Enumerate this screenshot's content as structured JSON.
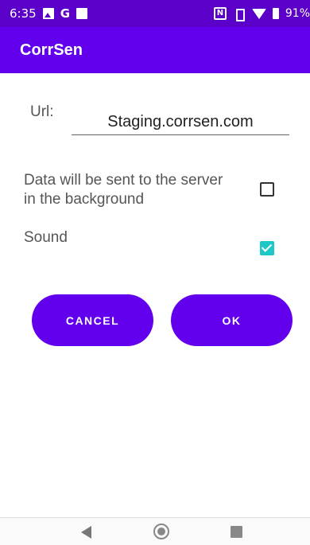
{
  "status_bar": {
    "time": "6:35",
    "battery_text": "91%",
    "icons": [
      "gallery-icon",
      "google-icon",
      "calendar-icon",
      "nfc-icon",
      "vibrate-icon",
      "wifi-icon",
      "battery-icon"
    ],
    "google_glyph": "G",
    "nfc_glyph": "N"
  },
  "app_bar": {
    "title": "CorrSen"
  },
  "form": {
    "url_label": "Url:",
    "url_value": "Staging.corrsen.com",
    "background_label": "Data will be sent to the server in the background",
    "background_checked": false,
    "sound_label": "Sound",
    "sound_checked": true
  },
  "buttons": {
    "cancel": "CANCEL",
    "ok": "OK"
  },
  "colors": {
    "primary": "#6200ee",
    "status_bar": "#5a00c8",
    "accent": "#1ec8c8"
  },
  "nav_bar": {
    "icons": [
      "back-icon",
      "home-icon",
      "recents-icon"
    ]
  }
}
